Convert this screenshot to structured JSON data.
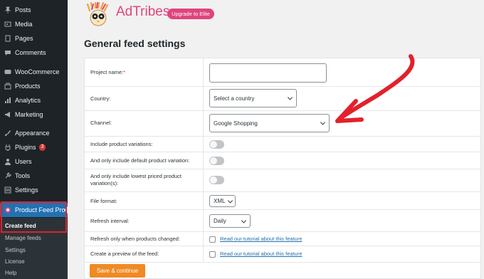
{
  "sidebar": {
    "items": [
      {
        "label": "Posts",
        "icon": "pin-icon"
      },
      {
        "label": "Media",
        "icon": "media-icon"
      },
      {
        "label": "Pages",
        "icon": "pages-icon"
      },
      {
        "label": "Comments",
        "icon": "comments-icon"
      },
      {
        "label": "WooCommerce",
        "icon": "woocommerce-icon"
      },
      {
        "label": "Products",
        "icon": "products-icon"
      },
      {
        "label": "Analytics",
        "icon": "analytics-icon"
      },
      {
        "label": "Marketing",
        "icon": "marketing-icon"
      },
      {
        "label": "Appearance",
        "icon": "brush-icon"
      },
      {
        "label": "Plugins",
        "icon": "plugin-icon",
        "badge": "3"
      },
      {
        "label": "Users",
        "icon": "users-icon"
      },
      {
        "label": "Tools",
        "icon": "tools-icon"
      },
      {
        "label": "Settings",
        "icon": "settings-icon"
      },
      {
        "label": "Product Feed Pro",
        "icon": "product-feed-icon"
      }
    ],
    "submenu": [
      "Create feed",
      "Manage feeds",
      "Settings",
      "License",
      "Help"
    ]
  },
  "header": {
    "brand": "AdTribes",
    "upgrade_label": "Upgrade to Elite",
    "logo_icon": "adtribes-owl-logo"
  },
  "page": {
    "title": "General feed settings"
  },
  "form": {
    "project_name_label": "Project name:",
    "required_mark": "*",
    "project_name_value": "",
    "country_label": "Country:",
    "country_value": "Select a country",
    "channel_label": "Channel:",
    "channel_value": "Google Shopping",
    "variations_label": "Include product variations:",
    "default_variation_label": "And only include default product variation:",
    "lowest_priced_label": "And only include lowest priced product variation(s):",
    "file_format_label": "File format:",
    "file_format_value": "XML",
    "refresh_interval_label": "Refresh interval:",
    "refresh_interval_value": "Daily",
    "refresh_changed_label": "Refresh only when products changed:",
    "preview_label": "Create a preview of the feed:",
    "tutorial_link": "Read our tutorial about this feature",
    "save_label": "Save & continue"
  },
  "colors": {
    "sidebar_bg": "#1d2327",
    "active_blue": "#2271b1",
    "brand_pink": "#e0447d",
    "save_orange": "#f08a24",
    "annotation_red": "#e2212b"
  }
}
